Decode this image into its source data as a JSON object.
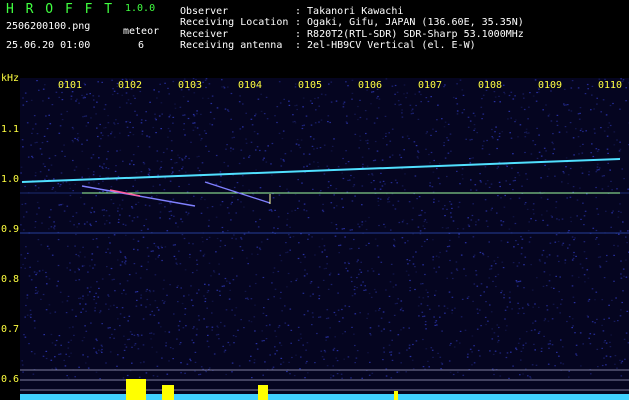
{
  "header": {
    "app_title": "H R O F F T",
    "version": "1.0.0",
    "filename": "2506200100.png",
    "datetime": "25.06.20 01:00",
    "meteor_label": "meteor",
    "meteor_count": "6",
    "observer_label": "Observer",
    "observer_value": ": Takanori Kawachi",
    "location_label": "Receiving Location",
    "location_value": ": Ogaki, Gifu, JAPAN (136.60E, 35.35N)",
    "receiver_label": "Receiver",
    "receiver_value": ": R820T2(RTL-SDR) SDR-Sharp 53.1000MHz",
    "antenna_label": "Receiving antenna",
    "antenna_value": ": 2el-HB9CV Vertical (el. E-W)"
  },
  "axis": {
    "unit": "kHz",
    "x_ticks": [
      "0101",
      "0102",
      "0103",
      "0104",
      "0105",
      "0106",
      "0107",
      "0108",
      "0109",
      "0110"
    ],
    "y_ticks": [
      "1.1",
      "1.0",
      "0.9",
      "0.8",
      "0.7",
      "0.6"
    ]
  },
  "colors": {
    "text_yellow": "#ffff40",
    "text_white": "#ffffff",
    "background": "#000000",
    "noise_blue": "#1a1a80",
    "trace_cyan": "#40e0ff",
    "bar_yellow": "#ffff00"
  }
}
